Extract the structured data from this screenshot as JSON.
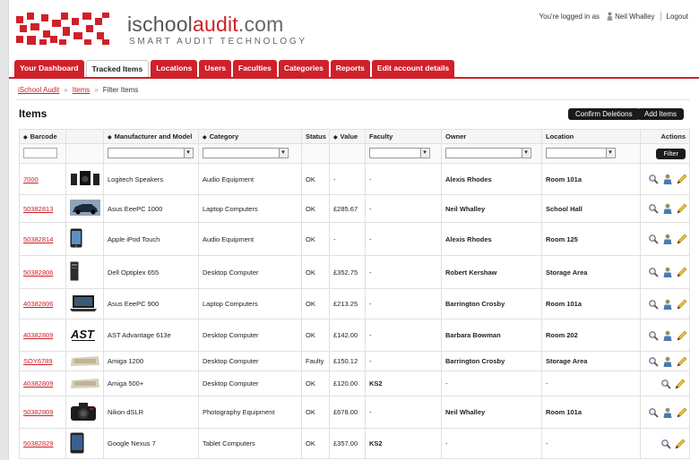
{
  "brand": {
    "prefix": "ischool",
    "accent": "audit",
    "domain": ".com",
    "tagline": "SMART AUDIT TECHNOLOGY"
  },
  "user": {
    "logged_in_label": "You're logged in as",
    "name": "Neil Whalley",
    "logout": "Logout"
  },
  "tabs": [
    "Your Dashboard",
    "Tracked Items",
    "Locations",
    "Users",
    "Faculties",
    "Categories",
    "Reports",
    "Edit account details"
  ],
  "active_tab": 1,
  "breadcrumb": {
    "home": "iSchool Audit",
    "items": "Items",
    "current": "Filter Items"
  },
  "page": {
    "title": "Items",
    "confirm_deletions": "Confirm Deletions",
    "add_items": "Add Items"
  },
  "table": {
    "headers": {
      "barcode": "Barcode",
      "manufacturer": "Manufacturer and Model",
      "category": "Category",
      "status": "Status",
      "value": "Value",
      "faculty": "Faculty",
      "owner": "Owner",
      "location": "Location",
      "actions": "Actions"
    },
    "filter_button": "Filter",
    "rows": [
      {
        "barcode": "7000",
        "model": "Logitech Speakers",
        "category": "Audio Equipment",
        "status": "OK",
        "value": "-",
        "faculty": "-",
        "owner": "Alexis Rhodes",
        "location": "Room 101a",
        "thumb": "speakers",
        "editable": true
      },
      {
        "barcode": "50382813",
        "model": "Asus EeePC 1000",
        "category": "Laptop Computers",
        "status": "OK",
        "value": "£285.67",
        "faculty": "-",
        "owner": "Neil Whalley",
        "location": "School Hall",
        "thumb": "car",
        "editable": true
      },
      {
        "barcode": "50382814",
        "model": "Apple iPod Touch",
        "category": "Audio Equipment",
        "status": "OK",
        "value": "-",
        "faculty": "-",
        "owner": "Alexis Rhodes",
        "location": "Room 125",
        "thumb": "ipod",
        "editable": true
      },
      {
        "barcode": "50382806",
        "model": "Dell Optiplex 655",
        "category": "Desktop Computer",
        "status": "OK",
        "value": "£352.75",
        "faculty": "-",
        "owner": "Robert Kershaw",
        "location": "Storage Area",
        "thumb": "tower",
        "editable": true
      },
      {
        "barcode": "40382806",
        "model": "Asus EeePC 900",
        "category": "Laptop Computers",
        "status": "OK",
        "value": "£213.25",
        "faculty": "-",
        "owner": "Barrington Crosby",
        "location": "Room 101a",
        "thumb": "laptop",
        "editable": true
      },
      {
        "barcode": "40382809",
        "model": "AST Advantage 613e",
        "category": "Desktop Computer",
        "status": "OK",
        "value": "£142.00",
        "faculty": "-",
        "owner": "Barbara Bowman",
        "location": "Room 202",
        "thumb": "ast",
        "editable": true
      },
      {
        "barcode": "SOY6789",
        "model": "Amiga 1200",
        "category": "Desktop Computer",
        "status": "Faulty",
        "value": "£150.12",
        "faculty": "-",
        "owner": "Barrington Crosby",
        "location": "Storage Area",
        "thumb": "amiga",
        "editable": true
      },
      {
        "barcode": "40382809",
        "model": "Amiga 500+",
        "category": "Desktop Computer",
        "status": "OK",
        "value": "£120.00",
        "faculty": "KS2",
        "owner": "-",
        "location": "-",
        "thumb": "amiga",
        "editable": false
      },
      {
        "barcode": "50382809",
        "model": "Nikon dSLR",
        "category": "Photography Equipment",
        "status": "OK",
        "value": "£678.00",
        "faculty": "-",
        "owner": "Neil Whalley",
        "location": "Room 101a",
        "thumb": "camera",
        "editable": true
      },
      {
        "barcode": "50382829",
        "model": "Google Nexus 7",
        "category": "Tablet Computers",
        "status": "OK",
        "value": "£357.00",
        "faculty": "KS2",
        "owner": "-",
        "location": "-",
        "thumb": "tablet",
        "editable": false
      }
    ]
  },
  "colors": {
    "brand_red": "#cf1f25",
    "tab_red": "#d0202a"
  }
}
